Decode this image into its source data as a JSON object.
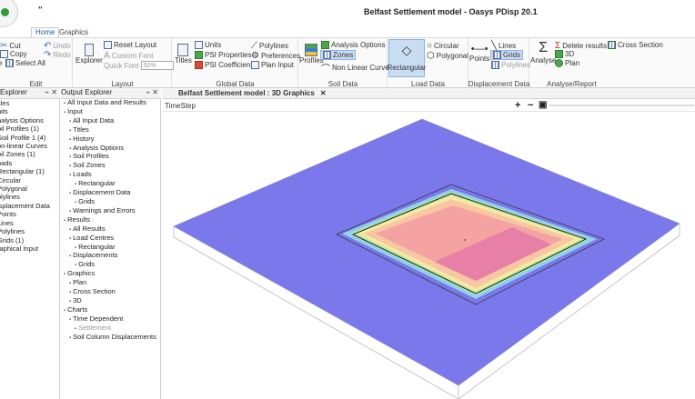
{
  "window": {
    "title": "Belfast Settlement model - Oasys PDisp 20.1",
    "qat_glyph": "\""
  },
  "ribbon_tabs": [
    {
      "label": "Home"
    },
    {
      "label": "Graphics"
    }
  ],
  "ribbon": {
    "edit": {
      "label": "Edit",
      "cut": "Cut",
      "copy": "Copy",
      "paste_partial": "e",
      "undo": "Undo",
      "redo": "Redo",
      "select_all": "Select All"
    },
    "layout": {
      "label": "Layout",
      "explorer": "Explorer",
      "reset_layout": "Reset Layout",
      "custom_font": "Custom Font",
      "quick_font": "Quick Font",
      "quick_font_value": "50%"
    },
    "global_data": {
      "label": "Global Data",
      "titles": "Titles",
      "units": "Units",
      "psi_properties": "PSI Properties",
      "psi_coefficients": "PSI Coefficients",
      "polylines": "Polylines",
      "preferences": "Preferences",
      "plan_input": "Plan Input"
    },
    "soil_data": {
      "label": "Soil Data",
      "profiles": "Profiles",
      "analysis_options": "Analysis Options",
      "zones": "Zones",
      "non_linear_curves": "Non Linear Curves"
    },
    "load_data": {
      "label": "Load Data",
      "rectangular": "Rectangular",
      "circular": "Circular",
      "polygonal": "Polygonal"
    },
    "displacement_data": {
      "label": "Displacement Data",
      "points": "Points",
      "lines": "Lines",
      "grids": "Grids",
      "polylines": "Polylines"
    },
    "analyse_report": {
      "label": "Analyse/Report",
      "analyse": "Analyse",
      "delete_results": "Delete results",
      "three_d": "3D",
      "plan": "Plan",
      "cross_section": "Cross Section"
    }
  },
  "input_explorer": {
    "title": "Explorer",
    "pin": "⌁ ✕",
    "items": [
      "itles",
      "nits",
      "nalysis Options",
      "oil Profiles (1)",
      "Soil Profile 1 (4)",
      "on-linear Curves",
      "oil Zones (1)",
      "oads",
      "Rectangular (1)",
      "Circular",
      "Polygonal",
      "olylines",
      "isplacement Data",
      "Points",
      "Lines",
      "Polylines",
      "Grids (1)",
      "raphical Input"
    ]
  },
  "output_explorer": {
    "title": "Output Explorer",
    "pin": "⌁ ✕",
    "items": [
      {
        "text": "All Input Data and Results",
        "indent": 0,
        "dim": false
      },
      {
        "text": "Input",
        "indent": 0,
        "dim": false
      },
      {
        "text": "All Input Data",
        "indent": 1,
        "dim": false
      },
      {
        "text": "Titles",
        "indent": 1,
        "dim": false
      },
      {
        "text": "History",
        "indent": 1,
        "dim": false
      },
      {
        "text": "Analysis Options",
        "indent": 1,
        "dim": false
      },
      {
        "text": "Soil Profiles",
        "indent": 1,
        "dim": false
      },
      {
        "text": "Soil Zones",
        "indent": 1,
        "dim": false
      },
      {
        "text": "Loads",
        "indent": 1,
        "dim": false
      },
      {
        "text": "Rectangular",
        "indent": 2,
        "dim": false
      },
      {
        "text": "Displacement Data",
        "indent": 1,
        "dim": false
      },
      {
        "text": "Grids",
        "indent": 2,
        "dim": false
      },
      {
        "text": "Warnings and Errors",
        "indent": 1,
        "dim": false
      },
      {
        "text": "Results",
        "indent": 0,
        "dim": false
      },
      {
        "text": "All Results",
        "indent": 1,
        "dim": false
      },
      {
        "text": "Load Centres",
        "indent": 1,
        "dim": false
      },
      {
        "text": "Rectangular",
        "indent": 2,
        "dim": false
      },
      {
        "text": "Displacements",
        "indent": 1,
        "dim": false
      },
      {
        "text": "Grids",
        "indent": 2,
        "dim": false
      },
      {
        "text": "Graphics",
        "indent": 0,
        "dim": false
      },
      {
        "text": "Plan",
        "indent": 1,
        "dim": false
      },
      {
        "text": "Cross Section",
        "indent": 1,
        "dim": false
      },
      {
        "text": "3D",
        "indent": 1,
        "dim": false
      },
      {
        "text": "Charts",
        "indent": 0,
        "dim": false
      },
      {
        "text": "Time Dependent",
        "indent": 1,
        "dim": false
      },
      {
        "text": "Settlement",
        "indent": 2,
        "dim": true
      },
      {
        "text": "Soil Column Displacements",
        "indent": 1,
        "dim": false
      }
    ]
  },
  "document": {
    "tab_title": "Belfast Settlement model : 3D Graphics",
    "tab_close": "✕",
    "timestep_label": "TimeStep",
    "zoom_in": "+",
    "zoom_out": "−",
    "fit": "▣"
  },
  "colors": {
    "ground": "#7a78ea",
    "contour_cyan": "#8fd0ee",
    "contour_green": "#b2e6a5",
    "contour_yellow": "#f7e9a0",
    "contour_orange": "#f7c6a3",
    "contour_salmon": "#f4a3a2",
    "contour_pink": "#e77fa6",
    "selected": "#c9ddf3"
  }
}
